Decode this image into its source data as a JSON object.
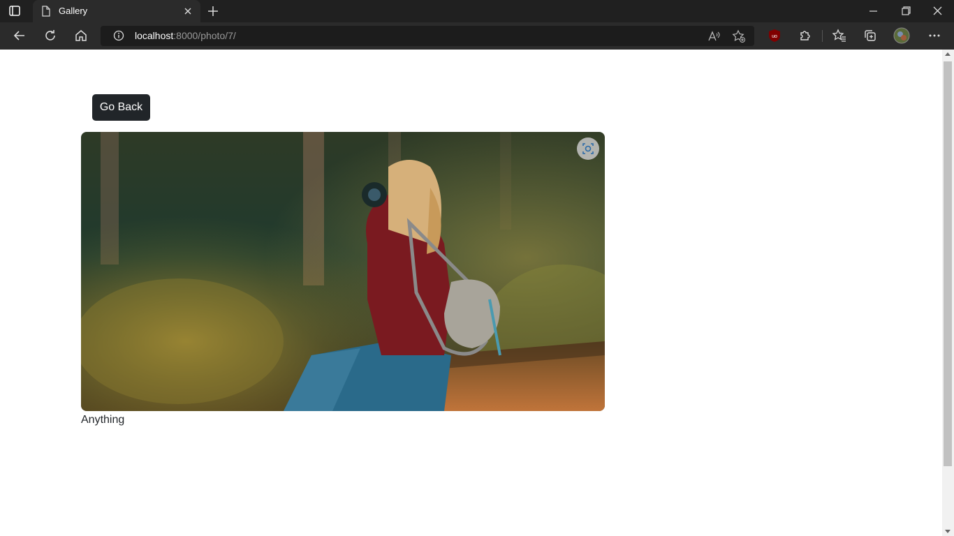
{
  "browser": {
    "tab_title": "Gallery",
    "url_host": "localhost",
    "url_rest": ":8000/photo/7/"
  },
  "page": {
    "go_back_label": "Go Back",
    "photo_caption": "Anything"
  },
  "icons": [
    "tab-actions-icon",
    "document-icon",
    "close-icon",
    "plus-icon",
    "minimize-icon",
    "restore-icon",
    "window-close-icon",
    "back-arrow-icon",
    "refresh-icon",
    "home-icon",
    "info-icon",
    "read-aloud-icon",
    "add-favorite-icon",
    "ublock-icon",
    "extensions-icon",
    "favorites-icon",
    "collections-icon",
    "profile-avatar-icon",
    "more-icon",
    "visual-search-icon"
  ]
}
